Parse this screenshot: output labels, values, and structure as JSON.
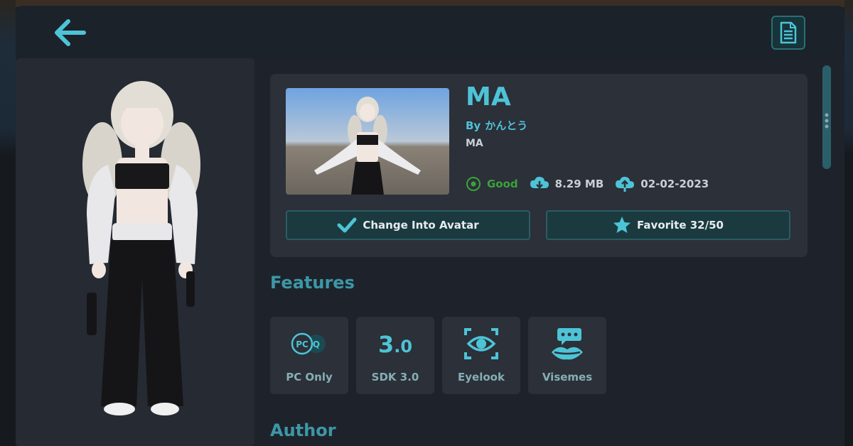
{
  "topbar": {
    "back_icon": "arrow-left-icon",
    "details_icon": "document-icon"
  },
  "avatar": {
    "title": "MA",
    "by_label": "By",
    "author": "かんとう",
    "description": "MA",
    "performance": "Good",
    "download_size": "8.29 MB",
    "upload_date": "02-02-2023"
  },
  "actions": {
    "change_label": "Change Into Avatar",
    "favorite_label": "Favorite 32/50"
  },
  "sections": {
    "features": "Features",
    "author": "Author"
  },
  "features": [
    {
      "label": "PC Only",
      "icon": "pc-quest-icon"
    },
    {
      "label": "SDK 3.0",
      "icon": "sdk-version-icon",
      "value": "3.0"
    },
    {
      "label": "Eyelook",
      "icon": "eye-tracking-icon"
    },
    {
      "label": "Visemes",
      "icon": "lips-speech-icon"
    }
  ],
  "colors": {
    "accent": "#4ec3d6",
    "good": "#3aa33a",
    "panel": "#2b3039",
    "button": "#1b3a3f"
  }
}
